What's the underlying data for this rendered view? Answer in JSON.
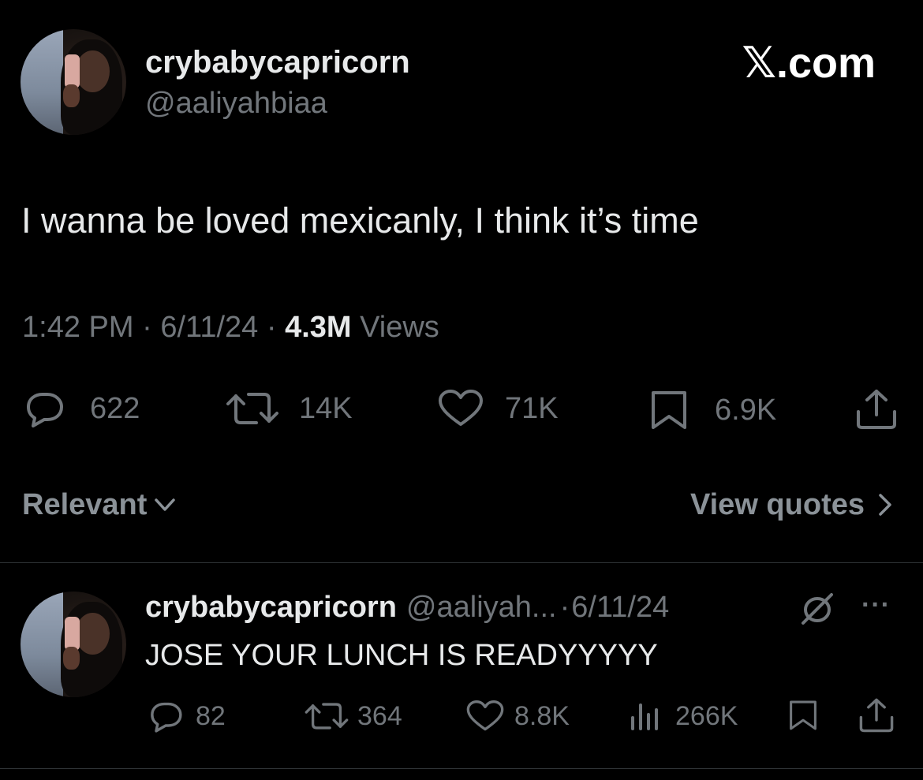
{
  "main_tweet": {
    "display_name": "crybabycapricorn",
    "handle": "@aaliyahbiaa",
    "text": "I wanna be loved mexicanly, I think it’s time",
    "time": "1:42 PM",
    "sep1": "·",
    "date": "6/11/24",
    "sep2": "·",
    "views_count": "4.3M",
    "views_label": "Views",
    "actions": {
      "replies": "622",
      "reposts": "14K",
      "likes": "71K",
      "bookmarks": "6.9K"
    }
  },
  "watermark": "𝕏.com",
  "sort": {
    "label": "Relevant",
    "view_quotes": "View quotes"
  },
  "reply": {
    "display_name": "crybabycapricorn",
    "handle": "@aaliyah...",
    "sep": "·",
    "date": "6/11/24",
    "more": "···",
    "text": "JOSE YOUR LUNCH IS READYYYYY",
    "actions": {
      "replies": "82",
      "reposts": "364",
      "likes": "8.8K",
      "views": "266K"
    }
  },
  "icons": {
    "reply": "reply-bubble-icon",
    "repost": "repost-arrows-icon",
    "like": "heart-icon",
    "bookmark": "bookmark-icon",
    "share": "share-upload-icon",
    "views": "bar-chart-icon",
    "grok": "grok-slash-circle-icon",
    "chevron_down": "chevron-down-icon",
    "chevron_right": "chevron-right-icon"
  },
  "colors": {
    "background": "#000000",
    "text_primary": "#e7e9ea",
    "text_muted": "#71767b",
    "divider": "#2f3336"
  }
}
